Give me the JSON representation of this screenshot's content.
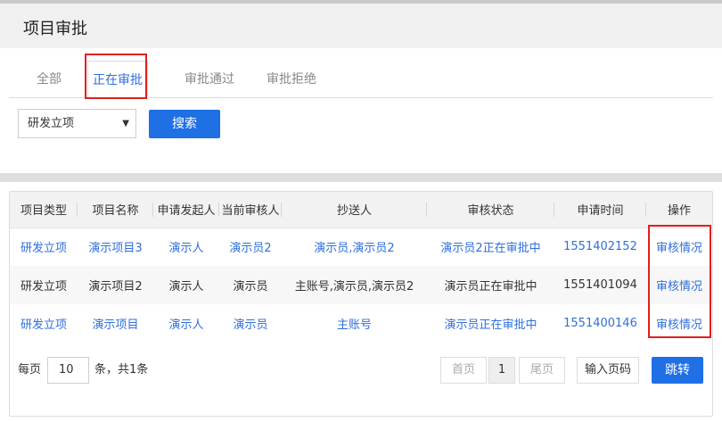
{
  "page": {
    "title": "项目审批"
  },
  "tabs": [
    {
      "label": "全部"
    },
    {
      "label": "正在审批"
    },
    {
      "label": "审批通过"
    },
    {
      "label": "审批拒绝"
    }
  ],
  "filter": {
    "selected": "研发立项",
    "search_label": "搜索"
  },
  "table": {
    "headers": [
      "项目类型",
      "项目名称",
      "申请发起人",
      "当前审核人",
      "抄送人",
      "审核状态",
      "申请时间",
      "操作"
    ],
    "rows": [
      [
        "研发立项",
        "演示项目3",
        "演示人",
        "演示员2",
        "演示员,演示员2",
        "演示员2正在审批中",
        "1551402152",
        "审核情况"
      ],
      [
        "研发立项",
        "演示项目2",
        "演示人",
        "演示员",
        "主账号,演示员,演示员2",
        "演示员正在审批中",
        "1551401094",
        "审核情况"
      ],
      [
        "研发立项",
        "演示项目",
        "演示人",
        "演示员",
        "主账号",
        "演示员正在审批中",
        "1551400146",
        "审核情况"
      ]
    ]
  },
  "pager": {
    "prefix": "每页",
    "page_size": "10",
    "suffix": "条，共1条",
    "first": "首页",
    "current": "1",
    "last": "尾页",
    "input_placeholder": "输入页码",
    "go": "跳转"
  },
  "colors": {
    "accent": "#1f6fe5",
    "link": "#2f6fdd",
    "highlight_box": "#e02020"
  }
}
